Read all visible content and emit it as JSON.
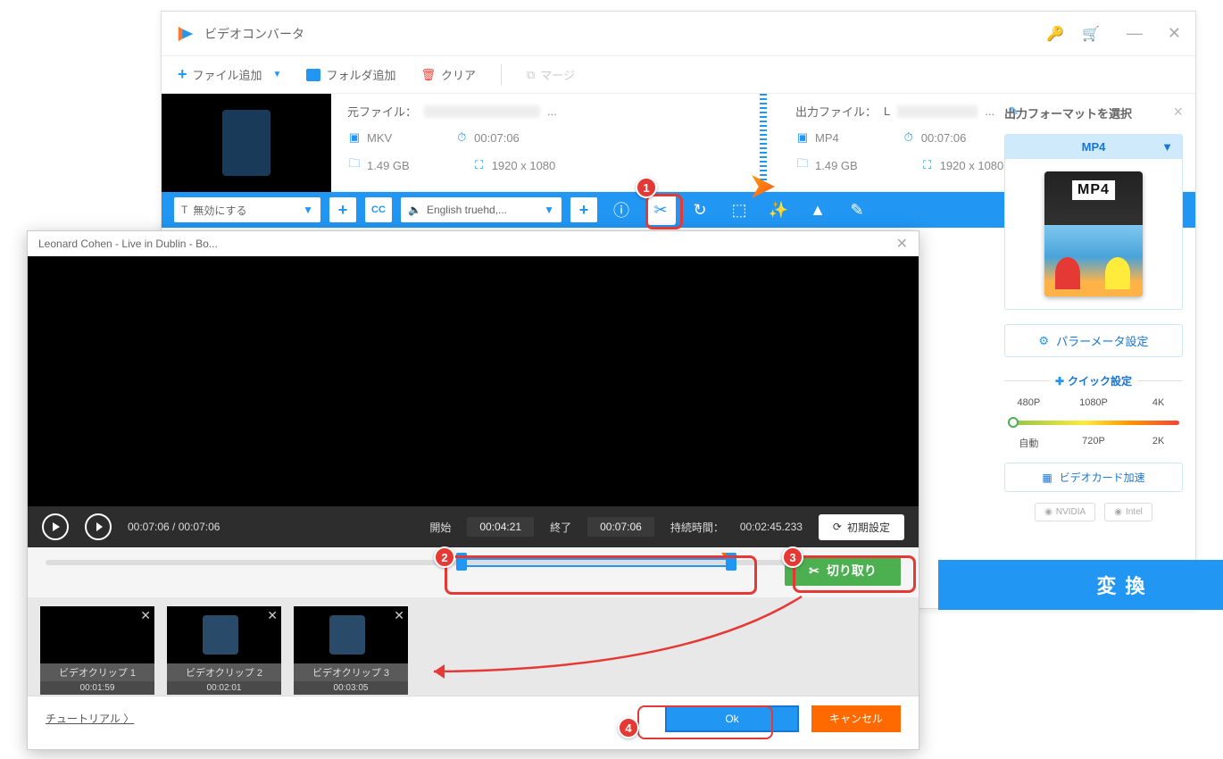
{
  "app": {
    "title": "ビデオコンバータ"
  },
  "toolbar": {
    "add_file": "ファイル追加",
    "add_folder": "フォルダ追加",
    "clear": "クリア",
    "merge": "マージ"
  },
  "file_row": {
    "source_label": "元ファイル：",
    "output_label": "出力ファイル：",
    "output_name_prefix": "L",
    "src_format": "MKV",
    "out_format": "MP4",
    "duration": "00:07:06",
    "size": "1.49 GB",
    "resolution": "1920 x 1080"
  },
  "action_bar": {
    "subtitle_dd": "無効にする",
    "audio_dd": "English truehd,..."
  },
  "right_panel": {
    "title": "出力フォーマットを選択",
    "format_name": "MP4",
    "mp4_card_label": "MP4",
    "param_btn": "パラーメータ設定",
    "quick_title": "クイック設定",
    "res": {
      "r480": "480P",
      "r1080": "1080P",
      "r4k": "4K",
      "auto": "自動",
      "r720": "720P",
      "r2k": "2K"
    },
    "hw_btn": "ビデオカード加速",
    "chips": {
      "nvidia": "NVIDIA",
      "intel": "Intel"
    }
  },
  "bottom": {
    "convert": "変換"
  },
  "editor": {
    "title": "Leonard Cohen - Live in Dublin - Bo...",
    "time_current": "00:07:06",
    "time_total": "00:07:06",
    "start_label": "開始",
    "start_val": "00:04:21",
    "end_label": "終了",
    "end_val": "00:07:06",
    "duration_label": "持続時間：",
    "duration_val": "00:02:45.233",
    "reset": "初期設定",
    "cut": "切り取り",
    "clips": [
      {
        "label": "ビデオクリップ 1",
        "time": "00:01:59"
      },
      {
        "label": "ビデオクリップ 2",
        "time": "00:02:01"
      },
      {
        "label": "ビデオクリップ 3",
        "time": "00:03:05"
      }
    ],
    "tutorial": "チュートリアル 〉",
    "ok": "Ok",
    "cancel": "キャンセル"
  },
  "badges": {
    "b1": "1",
    "b2": "2",
    "b3": "3",
    "b4": "4"
  }
}
